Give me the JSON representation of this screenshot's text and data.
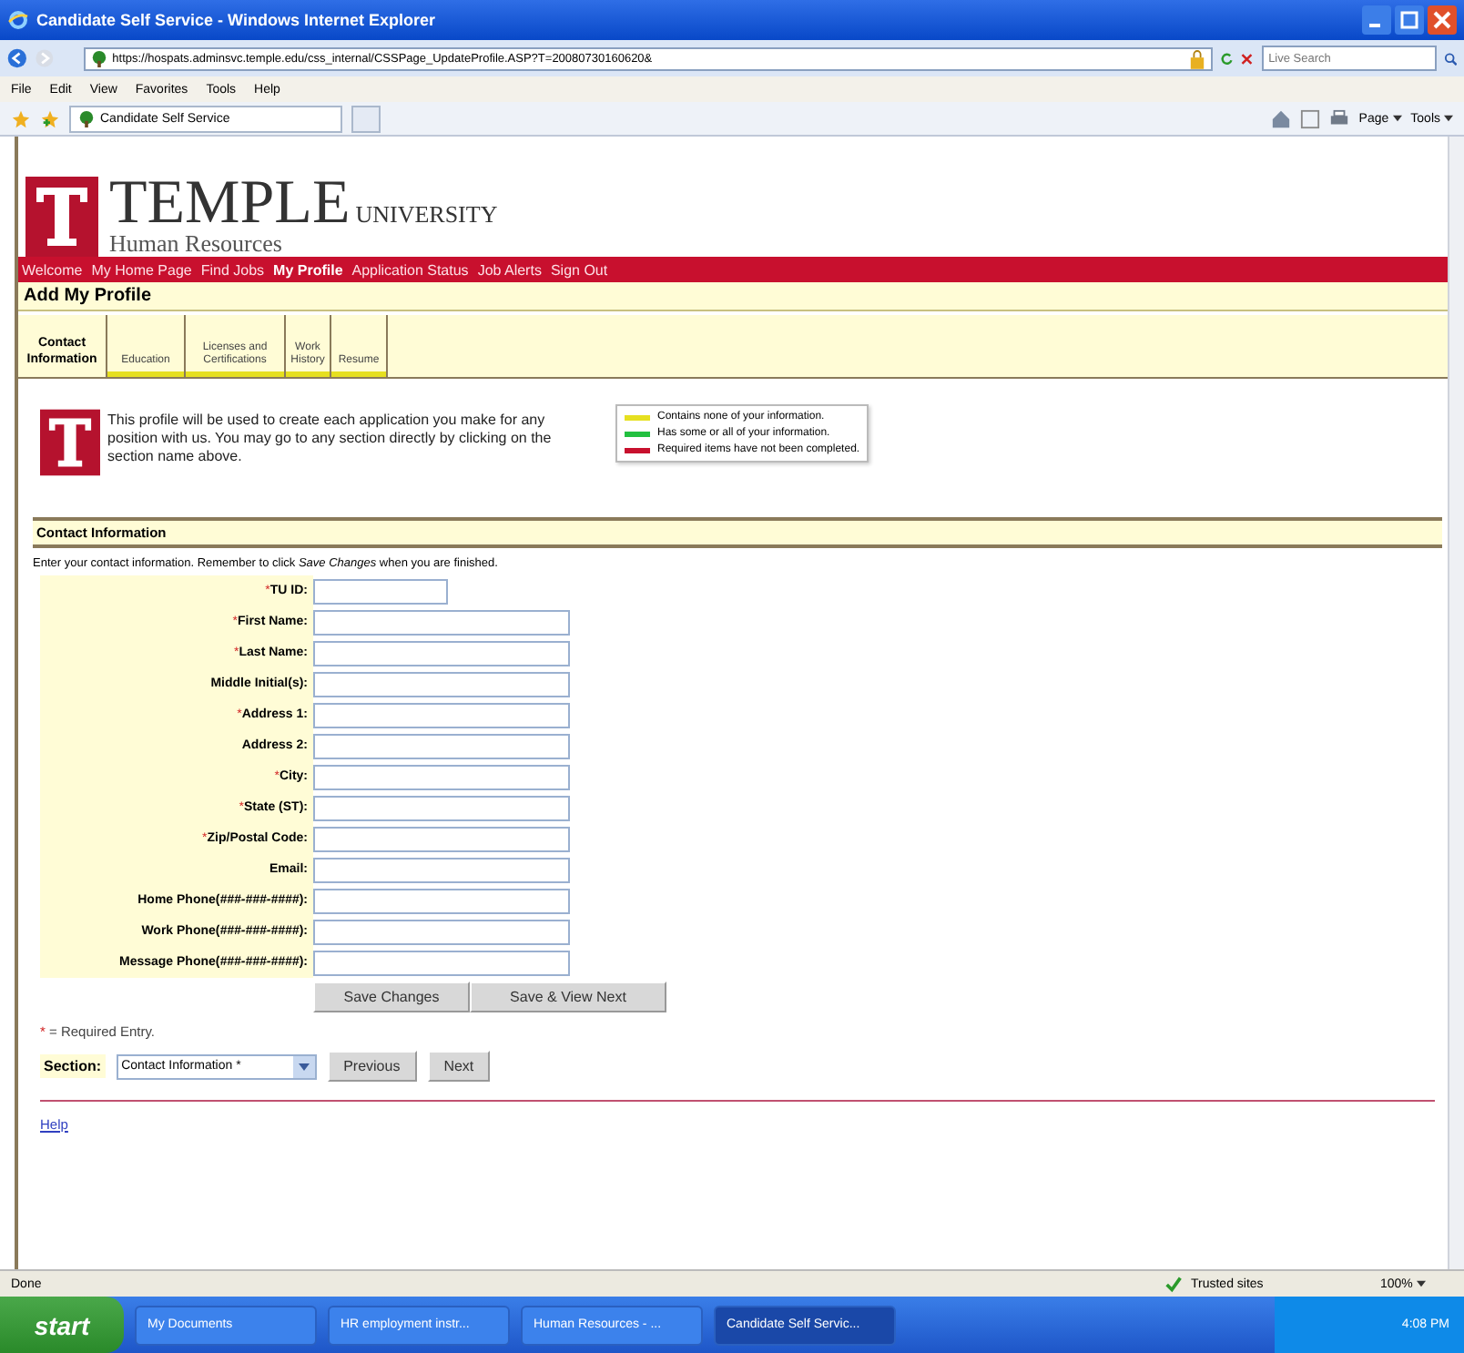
{
  "window": {
    "title": "Candidate Self Service - Windows Internet Explorer"
  },
  "address_bar": {
    "url": "https://hospats.adminsvc.temple.edu/css_internal/CSSPage_UpdateProfile.ASP?T=20080730160620&",
    "search_placeholder": "Live Search"
  },
  "menu": [
    "File",
    "Edit",
    "View",
    "Favorites",
    "Tools",
    "Help"
  ],
  "favorites_bar": {
    "tab": "Candidate Self Service",
    "tools": [
      "Page",
      "Tools"
    ]
  },
  "header": {
    "brand": "TEMPLE",
    "brand_suffix": "UNIVERSITY",
    "subtitle": "Human Resources"
  },
  "nav": [
    {
      "label": "Welcome",
      "selected": false
    },
    {
      "label": "My Home Page",
      "selected": false
    },
    {
      "label": "Find Jobs",
      "selected": false
    },
    {
      "label": "My Profile",
      "selected": true
    },
    {
      "label": "Application Status",
      "selected": false
    },
    {
      "label": "Job Alerts",
      "selected": false
    },
    {
      "label": "Sign Out",
      "selected": false
    }
  ],
  "page_title": "Add My Profile",
  "tabs": [
    {
      "label": "Contact Information",
      "selected": true
    },
    {
      "label": "Education",
      "selected": false,
      "color": "#e6e020"
    },
    {
      "label": "Licenses and Certifications",
      "selected": false,
      "color": "#e6e020"
    },
    {
      "label": "Work History",
      "selected": false,
      "color": "#e6e020"
    },
    {
      "label": "Resume",
      "selected": false,
      "color": "#e6e020"
    }
  ],
  "intro": "This profile will be used to create each application you make for any position with us. You may go to any section directly by clicking on the section name above.",
  "legend": [
    {
      "label": "Contains none of your information.",
      "color": "#e6e020"
    },
    {
      "label": "Has some or all of your information.",
      "color": "#22c040"
    },
    {
      "label": "Required items have not been completed.",
      "color": "#c8102e"
    }
  ],
  "section_title": "Contact Information",
  "instructions": "Enter your contact information.  Remember to click *Save Changes* when you are finished.",
  "fields": [
    {
      "mark": "*",
      "label": "TU ID:",
      "kind": "short"
    },
    {
      "mark": "*",
      "label": "First Name:",
      "kind": "long"
    },
    {
      "mark": "*",
      "label": "Last Name:",
      "kind": "long"
    },
    {
      "label": "Middle Initial(s):",
      "kind": "long"
    },
    {
      "mark": "*",
      "label": "Address 1:",
      "kind": "long"
    },
    {
      "label": "Address 2:",
      "kind": "long"
    },
    {
      "mark": "*",
      "label": "City:",
      "kind": "long"
    },
    {
      "mark": "*",
      "label": "State (ST):",
      "kind": "long"
    },
    {
      "mark": "*",
      "label": "Zip/Postal Code:",
      "kind": "long"
    },
    {
      "label": "Email:",
      "kind": "long"
    },
    {
      "label": "Home Phone(*###-###-####*):",
      "kind": "long"
    },
    {
      "label": "Work Phone(*###-###-####*):",
      "kind": "long"
    },
    {
      "label": "Message Phone(*###-###-####*):",
      "kind": "long"
    }
  ],
  "form_buttons": [
    "Save Changes",
    "Save & View Next"
  ],
  "required_note": {
    "mark": "*",
    "text": "= Required Entry."
  },
  "section_select": {
    "label": "Section:",
    "value": "Contact Information *",
    "buttons": [
      "Previous",
      "Next"
    ]
  },
  "help_link": "Help",
  "status_bar": {
    "text": "Done",
    "zone": "Trusted sites",
    "zoom": "100%"
  },
  "taskbar": {
    "start": "start",
    "items": [
      {
        "label": "My Documents",
        "selected": false
      },
      {
        "label": "HR employment instr...",
        "selected": false
      },
      {
        "label": "Human Resources - ...",
        "selected": false
      },
      {
        "label": "Candidate Self Servic...",
        "selected": true
      }
    ],
    "clock": "4:08 PM"
  }
}
